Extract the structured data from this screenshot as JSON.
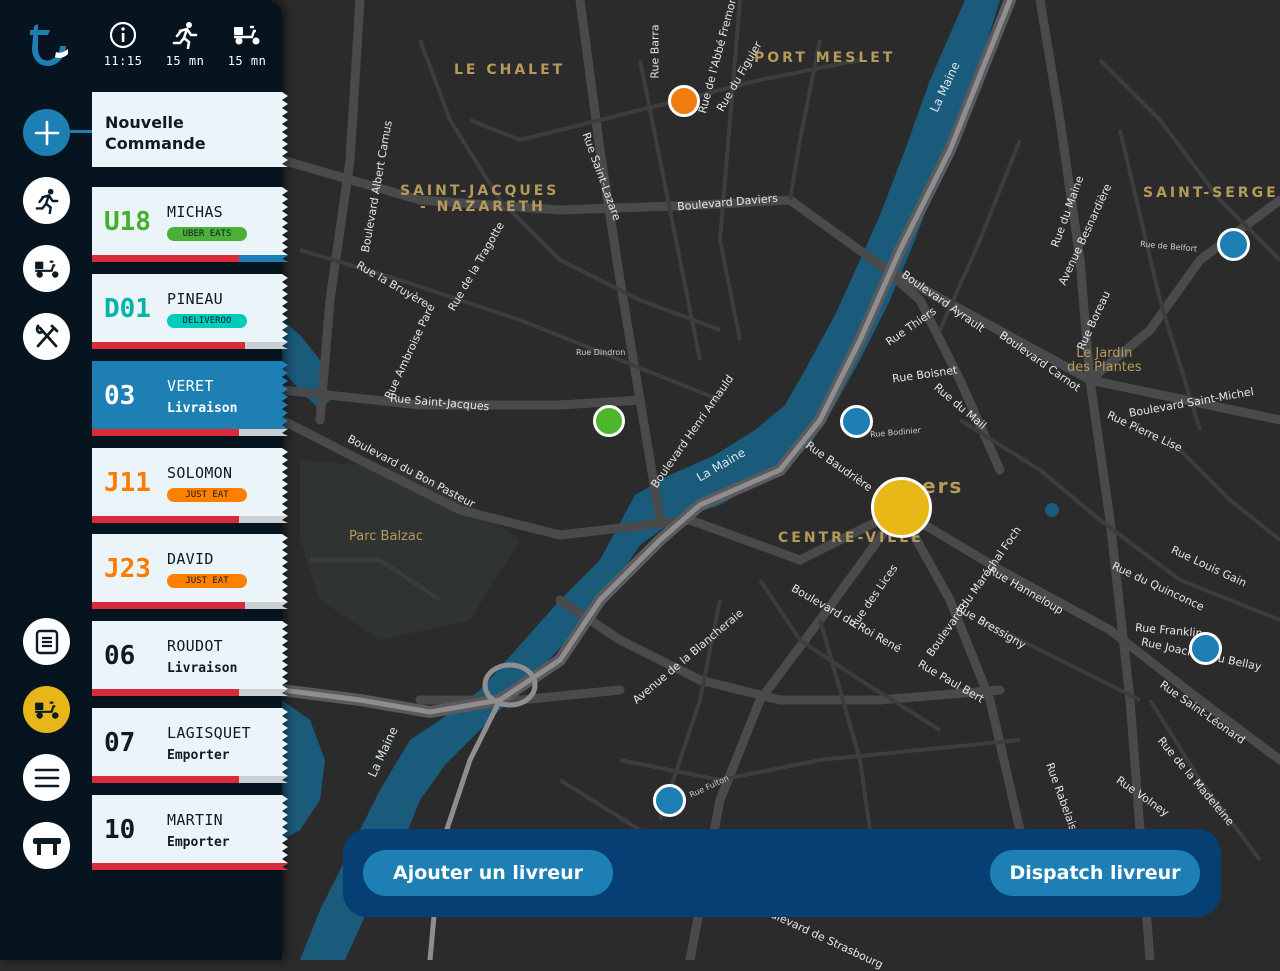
{
  "header": {
    "stats": [
      {
        "icon": "info-icon",
        "value": "11:15"
      },
      {
        "icon": "runner-icon",
        "value": "15 mn"
      },
      {
        "icon": "scooter-icon",
        "value": "15 mn"
      }
    ]
  },
  "rail": {
    "buttons_top": [
      "add-icon",
      "runner-icon",
      "scooter-icon",
      "utensils-icon"
    ],
    "buttons_bottom": [
      "list-icon",
      "scooter-icon",
      "menu-icon",
      "table-icon"
    ],
    "active_bottom": "scooter-icon"
  },
  "orders": {
    "new_order": {
      "line1": "Nouvelle",
      "line2": "Commande"
    },
    "items": [
      {
        "code": "U18",
        "name": "MICHAS",
        "tag": "UBER EATS",
        "tag_color": "#4caf38",
        "code_color": "#43b02a"
      },
      {
        "code": "D01",
        "name": "PINEAU",
        "tag": "DELIVEROO",
        "tag_color": "#00ccbc",
        "code_color": "#00b4a6"
      },
      {
        "code": "03",
        "name": "VERET",
        "sub": "Livraison",
        "active": true
      },
      {
        "code": "J11",
        "name": "SOLOMON",
        "tag": "JUST EAT",
        "tag_color": "#ff8000",
        "code_color": "#ff7a00"
      },
      {
        "code": "J23",
        "name": "DAVID",
        "tag": "JUST EAT",
        "tag_color": "#ff8000",
        "code_color": "#ff7a00"
      },
      {
        "code": "06",
        "name": "ROUDOT",
        "sub": "Livraison"
      },
      {
        "code": "07",
        "name": "LAGISQUET",
        "sub": "Emporter"
      },
      {
        "code": "10",
        "name": "MARTIN",
        "sub": "Emporter"
      }
    ]
  },
  "panel": {
    "add_driver": "Ajouter un livreur",
    "dispatch": "Dispatch livreur"
  },
  "map": {
    "districts": {
      "le_chalet": "LE CHALET",
      "port_meslet": "PORT MESLET",
      "saint_jacques_1": "SAINT-JACQUES",
      "saint_jacques_2": "- NAZARETH",
      "saint_serge": "SAINT-SERGE",
      "centre_ville": "CENTRE-VILLE",
      "angers": "ers",
      "jardin_1": "Le Jardin",
      "jardin_2": "des Plantes",
      "parc_balzac": "Parc Balzac"
    },
    "rivers": [
      "La Maine",
      "La Maine",
      "La Maine"
    ],
    "streets": {
      "s1": "Boulevard Daviers",
      "s2": "Rue Saint-Jacques",
      "s3": "Boulevard du Bon Pasteur",
      "s4": "Rue la Bruyère",
      "s5": "Boulevard Henri Arnauld",
      "s6": "Rue Baudrière",
      "s7": "Rue des Lices",
      "s8": "Boulevard du Roi René",
      "s9": "Boulevard Ayrault",
      "s10": "Boulevard Carnot",
      "s11": "Boulevard Saint-Michel",
      "s12": "Rue Pierre Lise",
      "s13": "Rue Louis Gain",
      "s14": "Rue du Quinconce",
      "s15": "Rue Franklin",
      "s16": "Rue Joachim du Bellay",
      "s17": "Rue Saint-Léonard",
      "s18": "Rue de la Madeleine",
      "s19": "Rue Volney",
      "s20": "Rue Paul Bert",
      "s21": "Rue Bressigny",
      "s22": "Rue Hanneloup",
      "s23": "Avenue de la Blancheraie",
      "s24": "Rue Boisnet",
      "s25": "Rue du Mail",
      "s26": "Boulevard Albert Camus",
      "s27": "Rue Saint-Lazare",
      "s28": "Rue de la Tragotte",
      "s29": "Rue Dindron",
      "s30": "Rue Ambroise Paré",
      "s31": "Rue du Figuier",
      "s32": "Rue de l'Abbé Fremond",
      "s33": "Rue Barra",
      "s34": "Rue Thiers",
      "s35": "Rue du Maine",
      "s36": "Avenue Besnardière",
      "s37": "Rue Boreau",
      "s38": "Rue de Belfort",
      "s39": "Boulevard du Maréchal Foch",
      "s40": "Boulevard de Strasbourg",
      "s41": "Rue Fulton",
      "s42": "Rue Bodinier",
      "s43": "Rue Rabelais"
    }
  }
}
